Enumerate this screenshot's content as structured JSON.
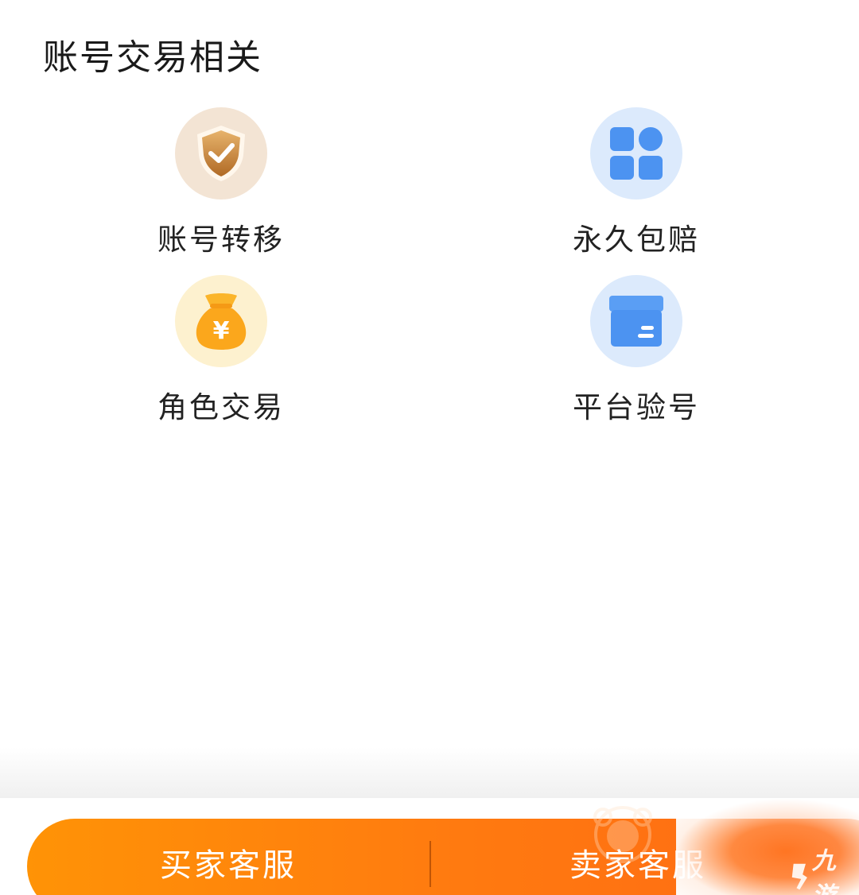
{
  "section": {
    "title": "账号交易相关"
  },
  "items": [
    {
      "label": "账号转移",
      "icon": "shield-check-icon",
      "bg": "#f3e4d4",
      "color": "#c98a3a"
    },
    {
      "label": "永久包赔",
      "icon": "apps-grid-icon",
      "bg": "#dceafc",
      "color": "#4c93f1"
    },
    {
      "label": "角色交易",
      "icon": "money-bag-icon",
      "bg": "#fdf1cf",
      "color": "#fba71c"
    },
    {
      "label": "平台验号",
      "icon": "box-icon",
      "bg": "#dceafc",
      "color": "#4c93f1"
    }
  ],
  "footer": {
    "buyer_label": "买家客服",
    "seller_label": "卖家客服",
    "accent": "#ff7a10"
  },
  "watermark": {
    "text": "九游"
  }
}
